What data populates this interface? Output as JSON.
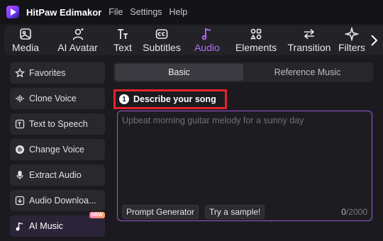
{
  "app": {
    "title": "HitPaw Edimakor",
    "menu": [
      "File",
      "Settings",
      "Help"
    ]
  },
  "toolbar": {
    "items": [
      {
        "label": "Media",
        "icon": "image-icon"
      },
      {
        "label": "AI Avatar",
        "icon": "avatar-icon"
      },
      {
        "label": "Text",
        "icon": "text-icon"
      },
      {
        "label": "Subtitles",
        "icon": "subtitles-icon"
      },
      {
        "label": "Audio",
        "icon": "music-note-icon",
        "active": true
      },
      {
        "label": "Elements",
        "icon": "elements-icon"
      },
      {
        "label": "Transition",
        "icon": "transition-icon"
      },
      {
        "label": "Filters",
        "icon": "sparkle-icon"
      }
    ],
    "scroll_icon": "chevron-right-icon"
  },
  "sidebar": {
    "items": [
      {
        "label": "Favorites",
        "icon": "star-icon"
      },
      {
        "label": "Clone Voice",
        "icon": "waveform-icon"
      },
      {
        "label": "Text to Speech",
        "icon": "text-speech-icon"
      },
      {
        "label": "Change Voice",
        "icon": "voice-change-icon"
      },
      {
        "label": "Extract Audio",
        "icon": "microphone-icon"
      },
      {
        "label": "Audio Downloa...",
        "icon": "download-icon"
      },
      {
        "label": "AI Music",
        "icon": "music-icon",
        "badge": "NEW",
        "active": true
      }
    ]
  },
  "main": {
    "tabs": [
      {
        "label": "Basic",
        "active": true
      },
      {
        "label": "Reference Music"
      }
    ],
    "step_number": "1",
    "step_label": "Describe your song",
    "prompt_placeholder": "Upbeat morning guitar melody for a sunny day",
    "prompt_generator_label": "Prompt Generator",
    "try_sample_label": "Try a sample!",
    "char_count": "0",
    "char_limit": "/2000"
  },
  "colors": {
    "accent": "#b66bff",
    "highlight_border": "#e3242b",
    "background": "#1b1b1f"
  }
}
